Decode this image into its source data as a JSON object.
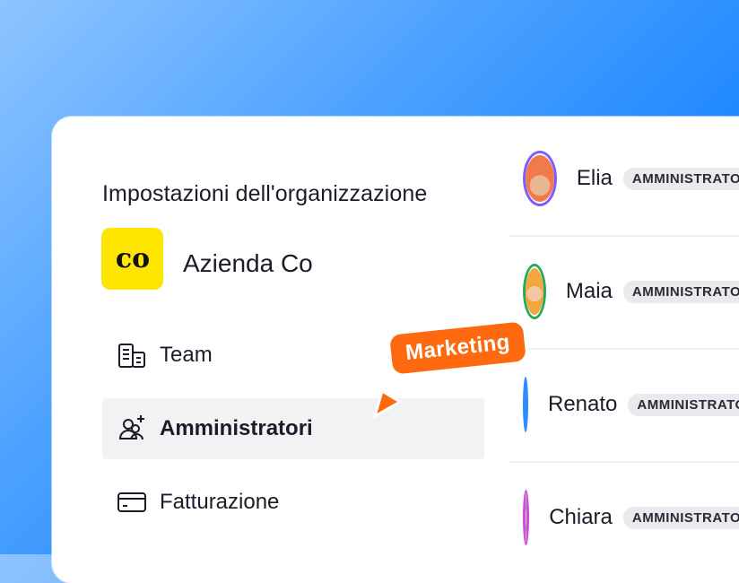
{
  "settings": {
    "title": "Impostazioni dell'organizzazione",
    "org_name": "Azienda Co",
    "org_logo_text": "co",
    "nav": [
      {
        "label": "Team",
        "icon": "building-icon"
      },
      {
        "label": "Amministratori",
        "icon": "add-user-icon",
        "active": true
      },
      {
        "label": "Fatturazione",
        "icon": "credit-card-icon"
      }
    ]
  },
  "members": [
    {
      "name": "Elia",
      "role": "AMMINISTRATORE",
      "ring": "#7c5cff",
      "bg": "#f07a4a"
    },
    {
      "name": "Maia",
      "role": "AMMINISTRATORE",
      "ring": "#27a85a",
      "bg": "#f3a63b"
    },
    {
      "name": "Renato",
      "role": "AMMINISTRATORE",
      "ring": "#2f8cff",
      "bg": "#e6488f"
    },
    {
      "name": "Chiara",
      "role": "AMMINISTRATORE",
      "ring": "#d14cd8",
      "bg": "#6cc56b"
    }
  ],
  "cursor": {
    "label": "Marketing",
    "color": "#ff6a10"
  }
}
